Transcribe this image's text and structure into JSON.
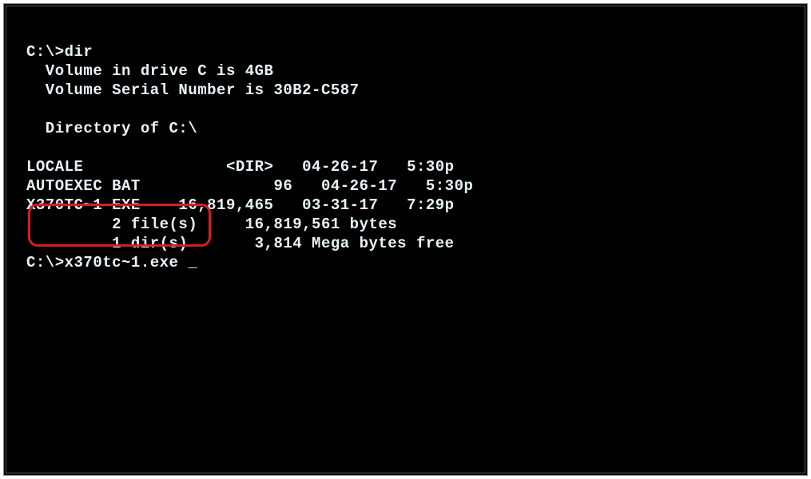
{
  "terminal": {
    "prompt1": "C:\\>",
    "command1": "dir",
    "volume_line": "  Volume in drive C is 4GB",
    "serial_line": "  Volume Serial Number is 30B2-C587",
    "blank1": "",
    "directory_line": "  Directory of C:\\",
    "blank2": "",
    "row1": "LOCALE               <DIR>   04-26-17   5:30p",
    "row2": "AUTOEXEC BAT              96   04-26-17   5:30p",
    "row3": "X370TC~1 EXE    16,819,465   03-31-17   7:29p",
    "summary1": "         2 file(s)     16,819,561 bytes",
    "summary2": "         1 dir(s)       3,814 Mega bytes free",
    "prompt2": "C:\\>",
    "command2": "x370tc~1.exe ",
    "cursor": "_"
  }
}
